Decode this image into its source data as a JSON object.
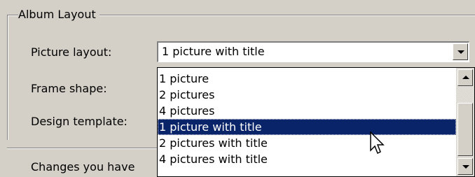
{
  "group": {
    "title": "Album Layout"
  },
  "fields": {
    "picture_layout_label": "Picture layout:",
    "frame_shape_label": "Frame shape:",
    "design_template_label": "Design template:"
  },
  "combo": {
    "value": "1 picture with title",
    "button_icon": "chevron-down-icon"
  },
  "dropdown": {
    "options": [
      "1 picture",
      "2 pictures",
      "4 pictures",
      "1 picture with title",
      "2 pictures with title",
      "4 pictures with title"
    ],
    "selected": "1 picture with title",
    "selected_color": "#0a246a"
  },
  "footer": {
    "changes_text": "Changes you have"
  },
  "colors": {
    "dialog_bg": "#d4d0c8",
    "highlight": "#0a246a"
  }
}
